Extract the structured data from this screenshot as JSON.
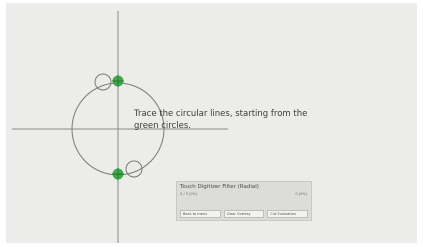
{
  "screen": {
    "instructions": "Trace the circular lines, starting from the green circles."
  },
  "panel": {
    "title": "Touch Digitizer Filter (Radial)",
    "subtitle_left": "0 / 3 (0%)",
    "subtitle_right": "0 (0%)",
    "buttons": {
      "back": "Back to menu",
      "clear": "Clear Overlay",
      "calibrate": "Cut Evaluation"
    }
  },
  "colors": {
    "start_marker": "#2ea43a",
    "line": "#7a7a7a"
  }
}
